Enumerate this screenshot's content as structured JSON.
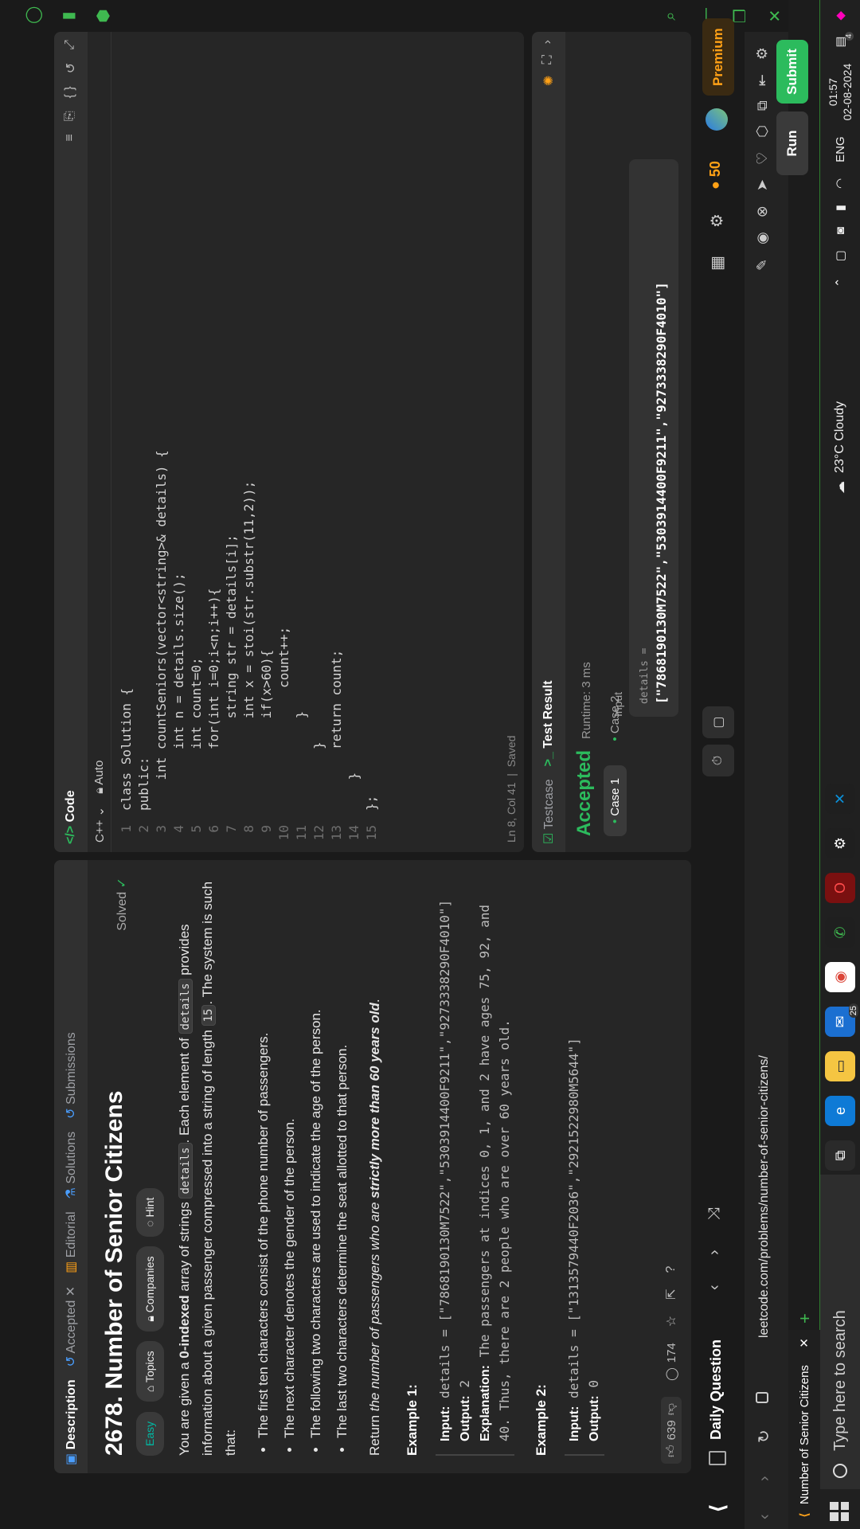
{
  "browser": {
    "tab_title": "Number of Senior Citizens",
    "url": "leetcode.com/problems/number-of-senior-citizens/"
  },
  "nav": {
    "daily_question": "Daily Question",
    "premium": "Premium",
    "streak": "50"
  },
  "description": {
    "tabs": [
      "Description",
      "Accepted",
      "Editorial",
      "Solutions",
      "Submissions"
    ],
    "title": "2678. Number of Senior Citizens",
    "solved": "Solved",
    "tags": [
      "Easy",
      "Topics",
      "Companies",
      "Hint"
    ],
    "intro_1": "You are given a ",
    "intro_bold": "0-indexed",
    "intro_2": " array of strings ",
    "intro_code": "details",
    "intro_3": ". Each element of ",
    "intro_code2": "details",
    "intro_4": " provides information about a given passenger compressed into a string of length ",
    "intro_code3": "15",
    "intro_5": ". The system is such that:",
    "rules": [
      "The first ten characters consist of the phone number of passengers.",
      "The next character denotes the gender of the person.",
      "The following two characters are used to indicate the age of the person.",
      "The last two characters determine the seat allotted to that person."
    ],
    "return_1": "Return ",
    "return_em": "the number of passengers who are ",
    "return_strong": "strictly more than 60 years old",
    "return_end": ".",
    "example1_title": "Example 1:",
    "example1_input_label": "Input:",
    "example1_input": "details = [\"7868190130M7522\",\"5303914400F9211\",\"9273338290F4010\"]",
    "example1_output_label": "Output:",
    "example1_output": "2",
    "example1_expl_label": "Explanation:",
    "example1_expl": "The passengers at indices 0, 1, and 2 have ages 75, 92, and 40. Thus, there are 2 people who are over 60 years old.",
    "example2_title": "Example 2:",
    "example2_input": "details = [\"1313579440F2036\",\"2921522980M5644\"]",
    "example2_output": "0",
    "likes": "639",
    "comments": "174"
  },
  "code": {
    "header": "Code",
    "language": "C++",
    "auto": "Auto",
    "status": "Ln 8, Col 41",
    "saved": "Saved",
    "lines": [
      "class Solution {",
      "public:",
      "    int countSeniors(vector<string>& details) {",
      "        int n = details.size();",
      "        int count=0;",
      "        for(int i=0;i<n;i++){",
      "            string str = details[i];",
      "            int x = stoi(str.substr(11,2));",
      "            if(x>60){",
      "                count++;",
      "            }",
      "        }",
      "        return count;",
      "    }",
      "};"
    ]
  },
  "result": {
    "tab_testcase": "Testcase",
    "tab_result": "Test Result",
    "status": "Accepted",
    "runtime": "Runtime: 3 ms",
    "cases": [
      "Case 1",
      "Case 2"
    ],
    "input_label": "Input",
    "param_label": "details =",
    "param_value": "[\"7868190130M7522\",\"5303914400F9211\",\"9273338290F4010\"]",
    "run": "Run",
    "submit": "Submit"
  },
  "taskbar": {
    "search_placeholder": "Type here to search",
    "weather": "23°C  Cloudy",
    "lang": "ENG",
    "time": "01:57",
    "date": "02-08-2024",
    "badge": "25",
    "notif": "4"
  }
}
